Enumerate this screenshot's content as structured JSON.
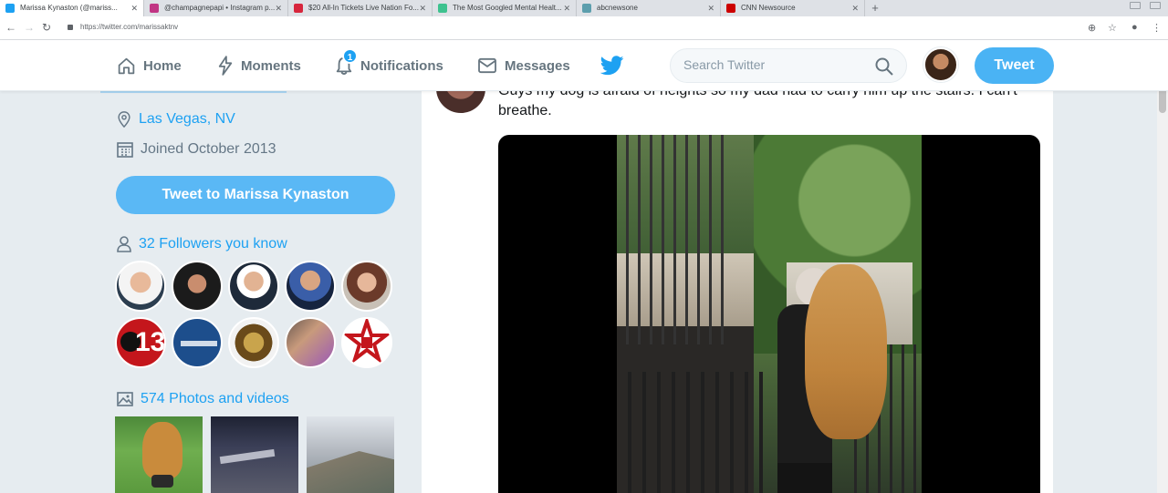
{
  "browser": {
    "tabs": [
      {
        "title": "Marissa Kynaston (@mariss...",
        "favicon_color": "#1da1f2",
        "active": true
      },
      {
        "title": "@champagnepapi • Instagram p...",
        "favicon_color": "#c13584",
        "active": false
      },
      {
        "title": "$20 All-In Tickets Live Nation Fo...",
        "favicon_color": "#d7263d",
        "active": false
      },
      {
        "title": "The Most Googled Mental Healt...",
        "favicon_color": "#3ec28f",
        "active": false
      },
      {
        "title": "abcnewsone",
        "favicon_color": "#5c9ead",
        "active": false
      },
      {
        "title": "CNN Newsource",
        "favicon_color": "#cc0000",
        "active": false
      }
    ],
    "new_tab": "+",
    "url": "https://twitter.com/marissaktnv"
  },
  "header": {
    "nav": [
      {
        "label": "Home",
        "icon": "home-icon"
      },
      {
        "label": "Moments",
        "icon": "lightning-icon"
      },
      {
        "label": "Notifications",
        "icon": "bell-icon",
        "badge": "1"
      },
      {
        "label": "Messages",
        "icon": "envelope-icon"
      }
    ],
    "search_placeholder": "Search Twitter",
    "tweet_button": "Tweet"
  },
  "profile": {
    "location": "Las Vegas, NV",
    "joined": "Joined October 2013",
    "tweet_to_button": "Tweet to Marissa Kynaston",
    "followers_you_know": "32 Followers you know",
    "photos_videos": "574 Photos and videos"
  },
  "tweet": {
    "text_line1": "Guys my dog is afraid of heights so my dad had to carry him up the stairs. I can't",
    "text_line2": "breathe."
  },
  "colors": {
    "twitter_blue": "#1da1f2",
    "tweet_button": "#4ab3f4",
    "page_background": "#e6ecf0",
    "secondary_text": "#657786"
  }
}
